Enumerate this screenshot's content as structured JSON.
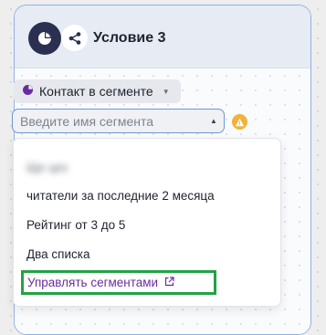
{
  "card": {
    "title": "Условие 3",
    "icons": {
      "main": "pie-chart-icon",
      "secondary": "share-nodes-icon"
    }
  },
  "condition": {
    "label": "Контакт в сегменте",
    "icon": "pie-chart-icon"
  },
  "segment_input": {
    "placeholder": "Введите имя сегмента",
    "value": ""
  },
  "warning_icon": "warning-icon",
  "dropdown": {
    "items": [
      "Ще цез",
      "читатели за последние 2 месяца",
      "Рейтинг от 3 до 5",
      "Два списка"
    ],
    "manage_label": "Управлять сегментами",
    "manage_icon": "external-link-icon"
  },
  "colors": {
    "accent_purple": "#6a2c9e",
    "header_dark": "#2b2f52",
    "warning": "#f2b23a",
    "highlight_green": "#23a244"
  }
}
